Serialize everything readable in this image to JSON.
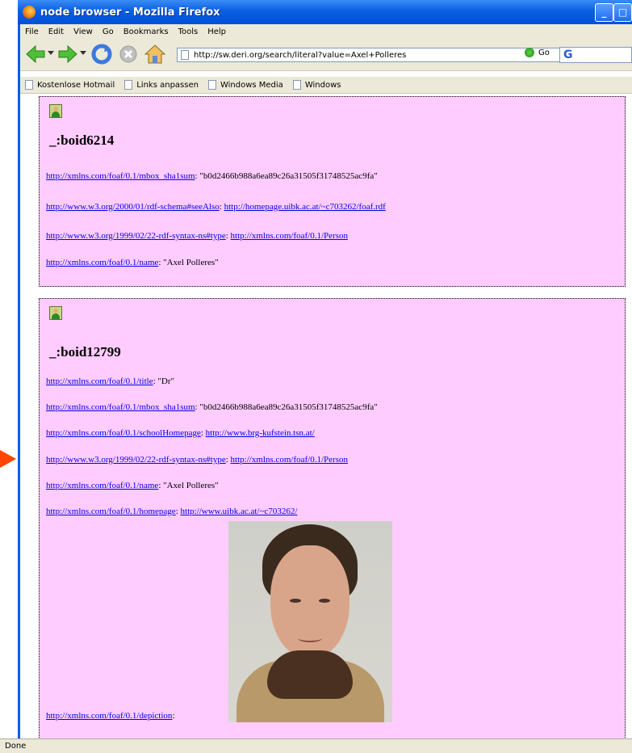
{
  "window": {
    "title": "node browser - Mozilla Firefox"
  },
  "menu": [
    "File",
    "Edit",
    "View",
    "Go",
    "Bookmarks",
    "Tools",
    "Help"
  ],
  "toolbar": {
    "url": "http://sw.deri.org/search/literal?value=Axel+Polleres",
    "go_label": "Go",
    "search_brand": "G"
  },
  "bookmarks": [
    "Kostenlose Hotmail",
    "Links anpassen",
    "Windows Media",
    "Windows"
  ],
  "nodes": [
    {
      "id": "_:boid6214",
      "props": [
        {
          "key": "http://xmlns.com/foaf/0.1/mbox_sha1sum",
          "value": "\"b0d2466b988a6ea89c26a31505f31748525ac9fa\""
        },
        {
          "key": "http://www.w3.org/2000/01/rdf-schema#seeAlso",
          "link": "http://homepage.uibk.ac.at/~c703262/foaf.rdf"
        },
        {
          "key": "http://www.w3.org/1999/02/22-rdf-syntax-ns#type",
          "link": "http://xmlns.com/foaf/0.1/Person"
        },
        {
          "key": "http://xmlns.com/foaf/0.1/name",
          "value": "\"Axel Polleres\""
        }
      ]
    },
    {
      "id": "_:boid12799",
      "props": [
        {
          "key": "http://xmlns.com/foaf/0.1/title",
          "value": "\"Dr\""
        },
        {
          "key": "http://xmlns.com/foaf/0.1/mbox_sha1sum",
          "value": "\"b0d2466b988a6ea89c26a31505f31748525ac9fa\""
        },
        {
          "key": "http://xmlns.com/foaf/0.1/schoolHomepage",
          "link": "http://www.brg-kufstein.tsn.at/"
        },
        {
          "key": "http://www.w3.org/1999/02/22-rdf-syntax-ns#type",
          "link": "http://xmlns.com/foaf/0.1/Person"
        },
        {
          "key": "http://xmlns.com/foaf/0.1/name",
          "value": "\"Axel Polleres\""
        },
        {
          "key": "http://xmlns.com/foaf/0.1/homepage",
          "link": "http://www.uibk.ac.at/~c703262/"
        },
        {
          "key": "http://xmlns.com/foaf/0.1/depiction"
        }
      ]
    }
  ],
  "status": "Done",
  "colors": {
    "content_bg": "#ffccff",
    "link": "#0000ee",
    "titlebar": "#0a5fe0",
    "arrow": "#ff4500"
  }
}
